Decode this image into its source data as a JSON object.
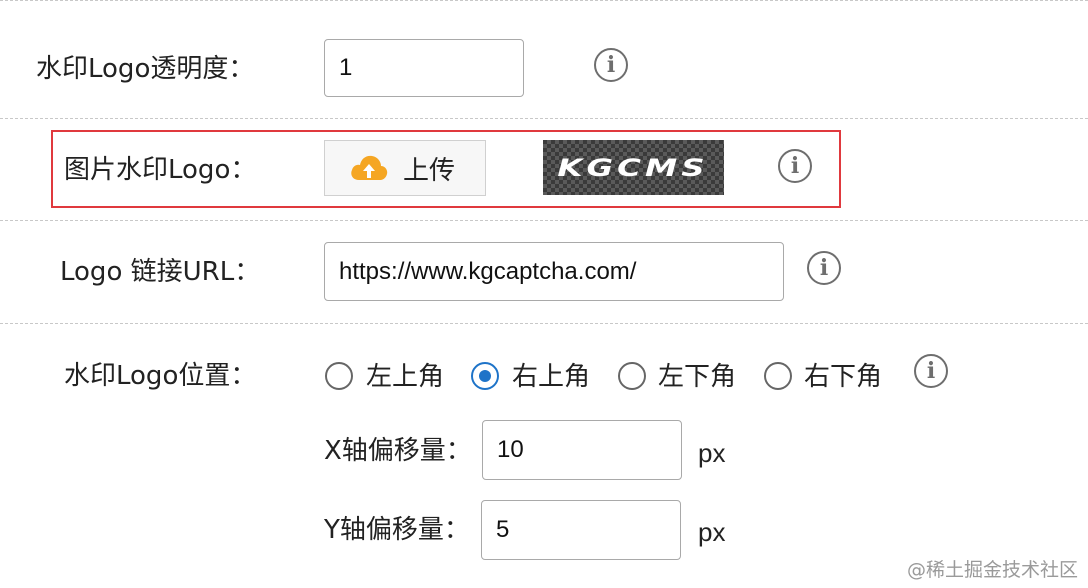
{
  "opacity": {
    "label": "水印Logo透明度：",
    "value": "1",
    "info_glyph": "i"
  },
  "image_logo": {
    "label": "图片水印Logo：",
    "upload_label": "上传",
    "upload_icon": "cloud-upload-icon",
    "preview_text": "KGCMS",
    "info_glyph": "i",
    "highlight_color": "#e0393e"
  },
  "link": {
    "label": "Logo 链接URL：",
    "value": "https://www.kgcaptcha.com/",
    "info_glyph": "i"
  },
  "position": {
    "label": "水印Logo位置：",
    "options": [
      "左上角",
      "右上角",
      "左下角",
      "右下角"
    ],
    "selected": "右上角",
    "info_glyph": "i",
    "accent_color": "#1e73c8"
  },
  "x_offset": {
    "label": "X轴偏移量：",
    "value": "10",
    "unit": "px"
  },
  "y_offset": {
    "label": "Y轴偏移量：",
    "value": "5",
    "unit": "px"
  },
  "watermark": "@稀土掘金技术社区"
}
